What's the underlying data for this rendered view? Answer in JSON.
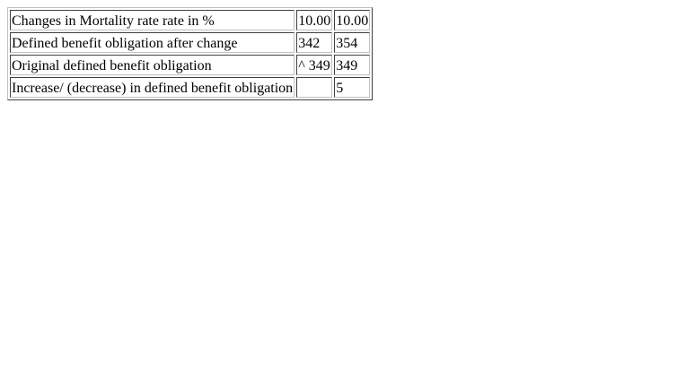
{
  "table": {
    "rows": [
      {
        "label": "Changes in Mortality rate rate in %",
        "col1": "10.00",
        "col2": "10.00"
      },
      {
        "label": "Defined benefit obligation after change",
        "col1": "342",
        "col2": "354"
      },
      {
        "label": "Original defined benefit obligation",
        "col1": "^ 349",
        "col2": "349"
      },
      {
        "label": "Increase/ (decrease) in defined benefit obligation",
        "col1": "",
        "col2": "5"
      }
    ]
  }
}
